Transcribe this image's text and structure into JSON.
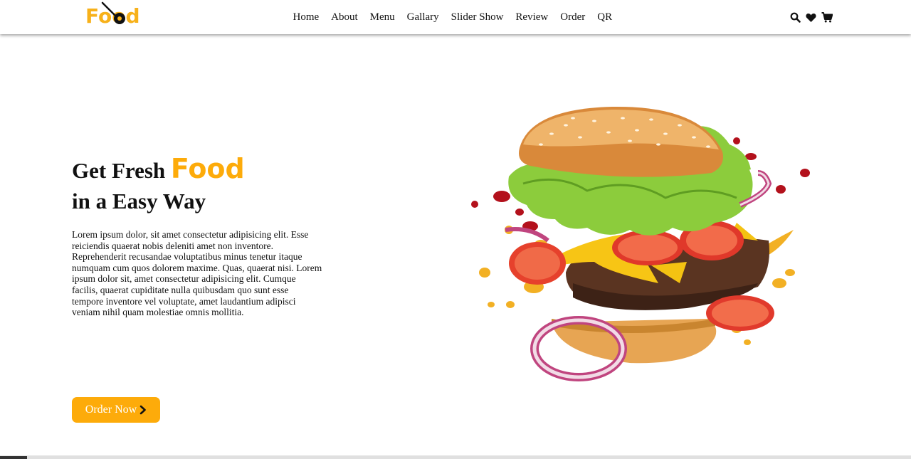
{
  "brand": {
    "logo_text": "Food",
    "accent_color": "#fdab0a"
  },
  "nav": {
    "links": [
      "Home",
      "About",
      "Menu",
      "Gallary",
      "Slider Show",
      "Review",
      "Order",
      "QR"
    ],
    "icons": [
      "search-icon",
      "heart-icon",
      "cart-icon"
    ]
  },
  "hero": {
    "title_part1": "Get Fresh",
    "title_accent": "Food",
    "title_line2": "in a Easy Way",
    "description": "Lorem ipsum dolor, sit amet consectetur adipisicing elit. Esse reiciendis quaerat nobis deleniti amet non inventore. Reprehenderit recusandae voluptatibus minus tenetur itaque numquam cum quos dolorem maxime. Quas, quaerat nisi. Lorem ipsum dolor sit, amet consectetur adipisicing elit. Cumque facilis, quaerat cupiditate nulla quibusdam quo sunt esse tempore inventore vel voluptate, amet laudantium adipisci veniam nihil quam molestiae omnis mollitia.",
    "button_label": "Order Now",
    "image": "burger-image"
  }
}
